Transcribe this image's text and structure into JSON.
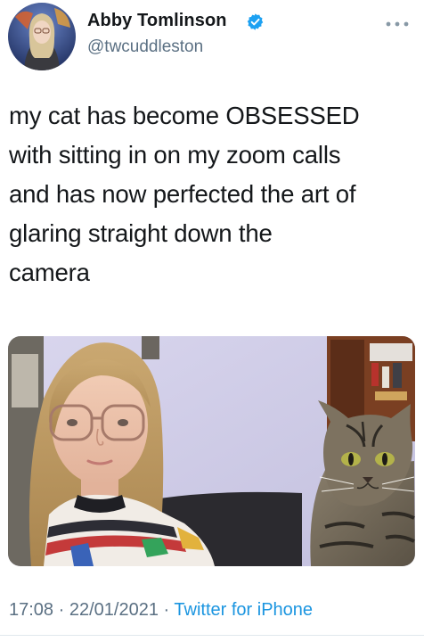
{
  "author": {
    "name": "Abby Tomlinson",
    "handle": "@twcuddleston",
    "verified": true,
    "avatar_icon": "profile-photo-icon"
  },
  "more_icon": "more-dots-icon",
  "tweet": {
    "text": "my cat has become OBSESSED\nwith sitting in on my zoom calls\nand has now perfected the art of\nglaring straight down the\ncamera"
  },
  "media": {
    "type": "photo"
  },
  "meta": {
    "time": "17:08",
    "date": "22/01/2021",
    "separator": "·",
    "source": "Twitter for iPhone"
  },
  "colors": {
    "text": "#14171a",
    "secondary": "#5b7083",
    "link": "#1b95e0",
    "verified": "#1da1f2"
  }
}
